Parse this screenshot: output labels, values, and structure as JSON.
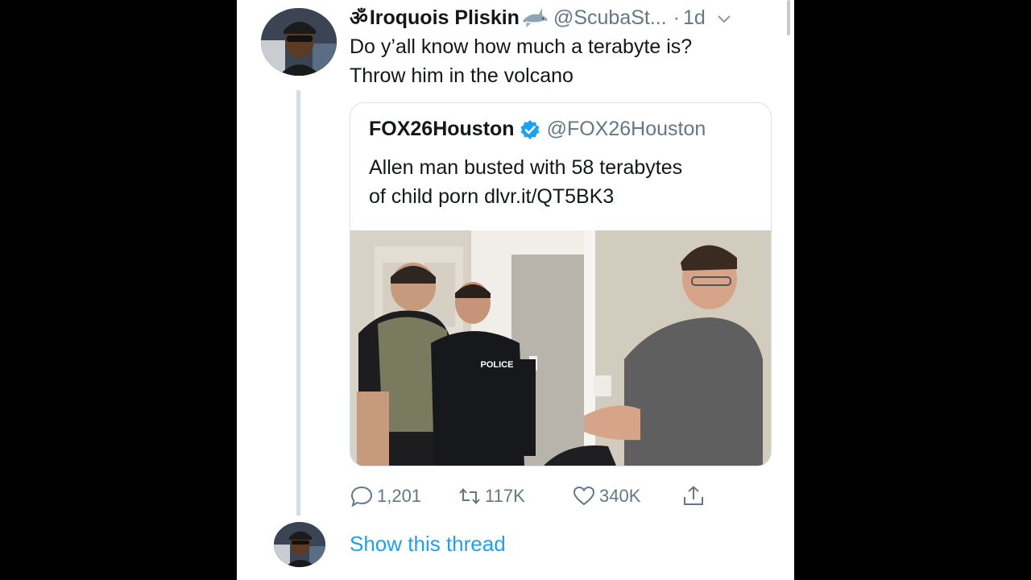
{
  "tweet": {
    "om_symbol": "ॐ",
    "author_name": "Iroquois Pliskin",
    "author_handle": "@ScubaSt...",
    "separator": "·",
    "time": "1d",
    "text_lines": [
      "Do y’all know how much a terabyte is?",
      "Throw him in the volcano"
    ]
  },
  "quoted_tweet": {
    "author_name": "FOX26Houston",
    "author_handle": "@FOX26Houston",
    "text_lines": [
      "Allen man busted with 58 terabytes",
      "of child porn dlvr.it/QT5BK3"
    ],
    "photo_text": "POLICE"
  },
  "actions": {
    "replies": "1,201",
    "retweets": "117K",
    "likes": "340K"
  },
  "thread": {
    "show_label": "Show this thread"
  },
  "icons": {
    "author_emoji": "shark-icon",
    "verified": "verified-badge-icon",
    "reply": "reply-icon",
    "retweet": "retweet-icon",
    "like": "heart-icon",
    "share": "share-icon",
    "menu": "chevron-down-icon"
  },
  "colors": {
    "link": "#1da1f2",
    "verified": "#1da1f2",
    "secondary_text": "#657786",
    "primary_text": "#14171a",
    "background": "#000000",
    "card": "#ffffff"
  }
}
